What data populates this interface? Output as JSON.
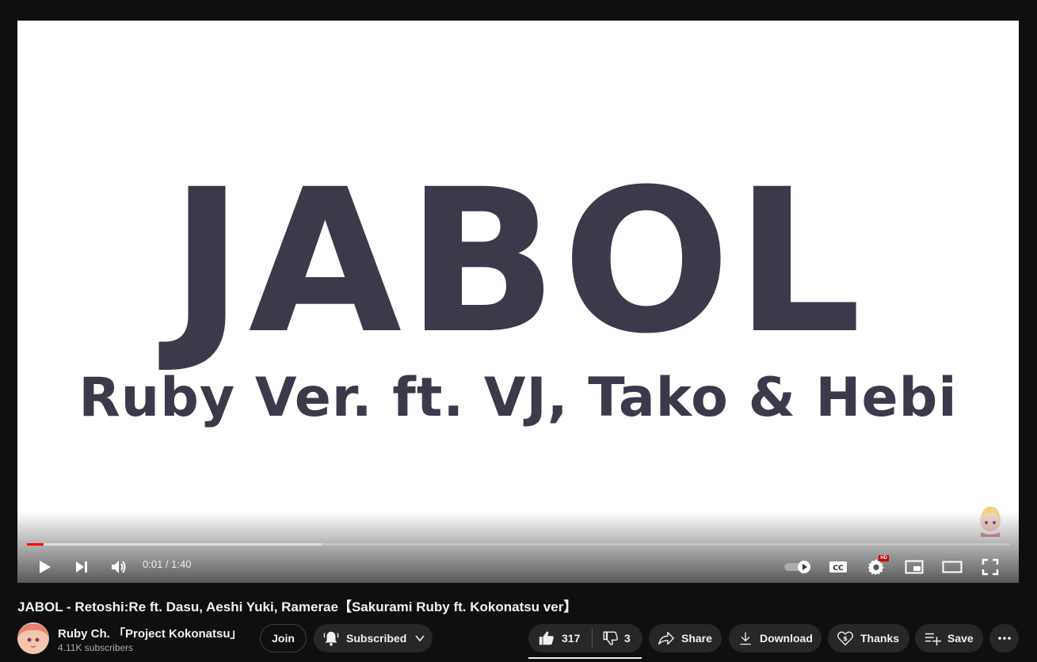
{
  "video_frame": {
    "title_text": "JABOL",
    "subtitle_text": "Ruby Ver. ft. VJ, Tako & Hebi"
  },
  "player": {
    "time_current": "0:01",
    "time_separator": " / ",
    "time_total": "1:40",
    "progress_played_fraction": 0.017,
    "progress_buffered_fraction": 0.3,
    "hd_badge": "HD",
    "accent_color": "#ff0000",
    "icons": [
      "play-icon",
      "next-icon",
      "volume-icon",
      "autoplay-toggle-icon",
      "captions-icon",
      "settings-icon",
      "miniplayer-icon",
      "theater-mode-icon",
      "fullscreen-icon"
    ]
  },
  "video": {
    "title": "JABOL - Retoshi:Re ft. Dasu, Aeshi Yuki, Ramerae【Sakurami Ruby ft. Kokonatsu ver】"
  },
  "channel": {
    "name": "Ruby Ch. 「Project Kokonatsu」",
    "subscribers": "4.11K subscribers"
  },
  "actions": {
    "join_label": "Join",
    "subscribed_label": "Subscribed",
    "like_count": "317",
    "dislike_count": "3",
    "share_label": "Share",
    "download_label": "Download",
    "thanks_label": "Thanks",
    "save_label": "Save"
  }
}
